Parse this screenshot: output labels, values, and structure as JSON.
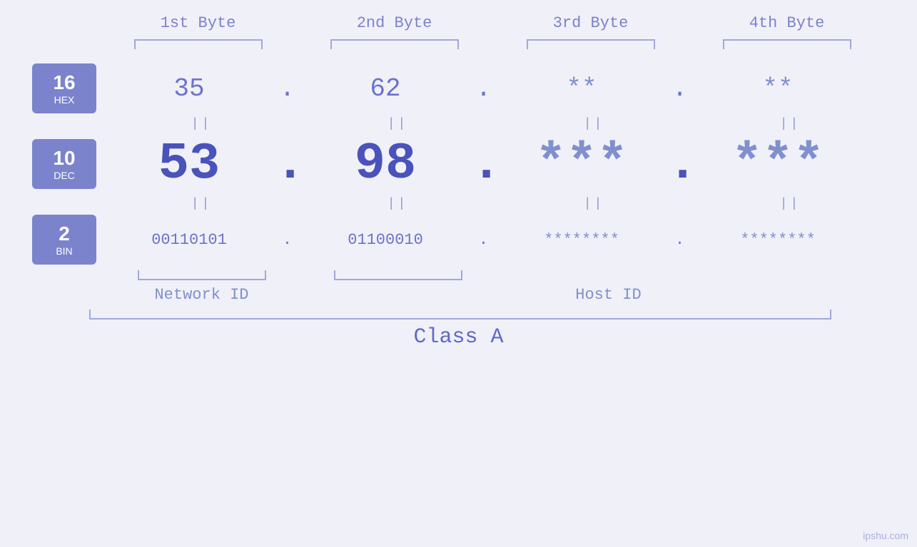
{
  "byteHeaders": [
    "1st Byte",
    "2nd Byte",
    "3rd Byte",
    "4th Byte"
  ],
  "hexRow": {
    "label": {
      "num": "16",
      "name": "HEX"
    },
    "values": [
      "35",
      "62",
      "**",
      "**"
    ],
    "separator": "."
  },
  "decRow": {
    "label": {
      "num": "10",
      "name": "DEC"
    },
    "values": [
      "53",
      "98",
      "***",
      "***"
    ],
    "separator": "."
  },
  "binRow": {
    "label": {
      "num": "2",
      "name": "BIN"
    },
    "values": [
      "00110101",
      "01100010",
      "********",
      "********"
    ],
    "separator": "."
  },
  "networkIdLabel": "Network ID",
  "hostIdLabel": "Host ID",
  "classLabel": "Class A",
  "watermark": "ipshu.com"
}
